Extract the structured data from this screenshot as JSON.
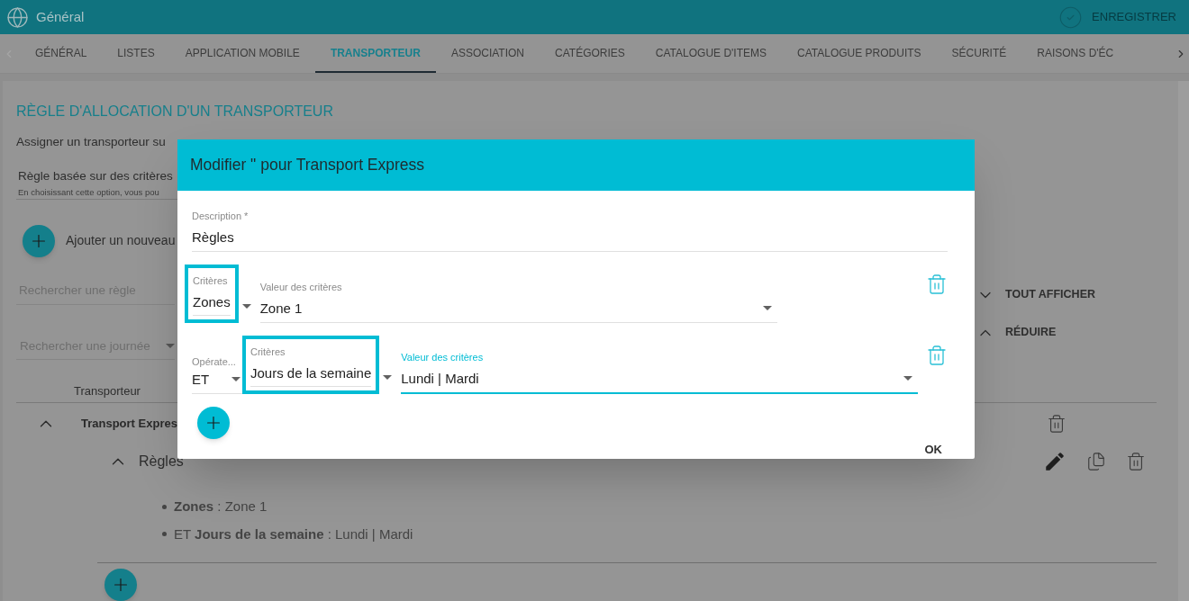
{
  "header": {
    "title": "Général",
    "save_label": "ENREGISTRER"
  },
  "tabs": [
    {
      "label": "GÉNÉRAL",
      "selected": false
    },
    {
      "label": "LISTES",
      "selected": false
    },
    {
      "label": "APPLICATION MOBILE",
      "selected": false
    },
    {
      "label": "TRANSPORTEUR",
      "selected": true
    },
    {
      "label": "ASSOCIATION",
      "selected": false
    },
    {
      "label": "CATÉGORIES",
      "selected": false
    },
    {
      "label": "CATALOGUE D'ITEMS",
      "selected": false
    },
    {
      "label": "CATALOGUE PRODUITS",
      "selected": false
    },
    {
      "label": "SÉCURITÉ",
      "selected": false
    },
    {
      "label": "RAISONS D'ÉC",
      "selected": false
    }
  ],
  "section": {
    "title": "RÈGLE D'ALLOCATION D'UN TRANSPORTEUR",
    "subtitle": "Assigner un transporteur su",
    "option_label": "Règle basée sur des critères",
    "option_hint": "En choisissant cette option, vous pou",
    "add_label": "Ajouter un nouveau",
    "search_rule_placeholder": "Rechercher une règle",
    "search_day_placeholder": "Rechercher une journée",
    "show_all": "TOUT AFFICHER",
    "collapse": "RÉDUIRE",
    "column": "Transporteur",
    "carrier": {
      "name": "Transport Expres",
      "expanded": true,
      "rules": [
        {
          "name": "Règles",
          "expanded": true,
          "items": [
            "**Zones** : Zone 1",
            "ET **Jours de la semaine** : Lundi | Mardi"
          ]
        }
      ]
    }
  },
  "dialog": {
    "title": "Modifier \" pour Transport Express",
    "description_label": "Description *",
    "description_value": "Règles",
    "criteria": [
      {
        "kind": "first",
        "criteria_label": "Critères",
        "criteria_value": "Zones",
        "highlighted": true,
        "value_label": "Valeur des critères",
        "value": "Zone 1",
        "focused": false
      },
      {
        "kind": "joined",
        "operator_label": "Opérate...",
        "operator": "ET",
        "criteria_label": "Critères",
        "criteria_value": "Jours de la semaine",
        "highlighted": true,
        "value_label": "Valeur des critères",
        "value": "Lundi | Mardi",
        "focused": true
      }
    ],
    "ok": "OK"
  }
}
